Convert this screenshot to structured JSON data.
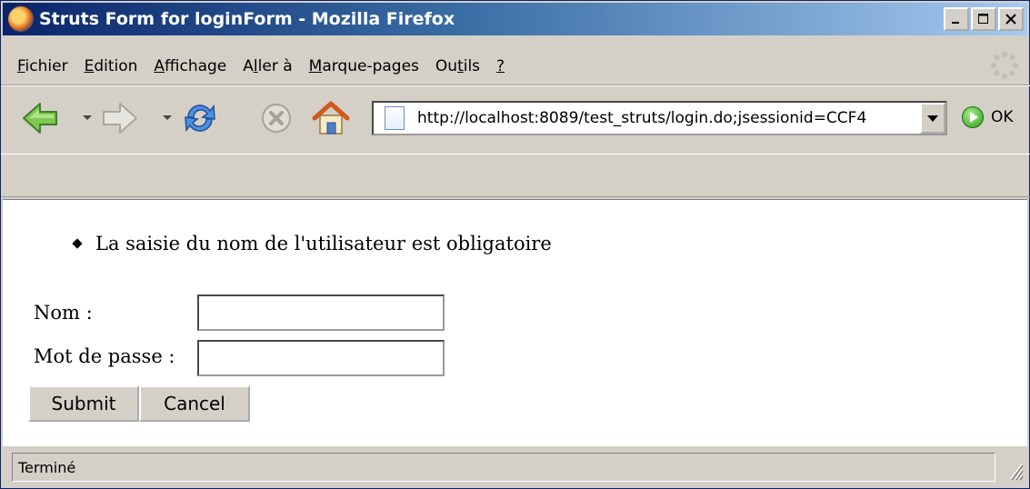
{
  "window": {
    "title": "Struts Form for loginForm - Mozilla Firefox",
    "controls": {
      "minimize": "_",
      "maximize": "□",
      "close": "×"
    }
  },
  "menu": [
    {
      "pre": "",
      "key": "F",
      "post": "ichier"
    },
    {
      "pre": "",
      "key": "E",
      "post": "dition"
    },
    {
      "pre": "",
      "key": "A",
      "post": "ffichage"
    },
    {
      "pre": "A",
      "key": "l",
      "post": "ler à"
    },
    {
      "pre": "",
      "key": "M",
      "post": "arque-pages"
    },
    {
      "pre": "Ou",
      "key": "t",
      "post": "ils"
    },
    {
      "pre": "",
      "key": "?",
      "post": ""
    }
  ],
  "toolbar": {
    "url": "http://localhost:8089/test_struts/login.do;jsessionid=CCF4",
    "go_label": "OK"
  },
  "page": {
    "error_message": "La saisie du nom de l'utilisateur est obligatoire",
    "name_label": "Nom :",
    "password_label": "Mot de passe :",
    "name_value": "",
    "password_value": "",
    "submit_label": "Submit",
    "cancel_label": "Cancel"
  },
  "status": {
    "text": "Terminé"
  },
  "colors": {
    "title_start": "#0a246a",
    "title_end": "#a6caf0",
    "chrome": "#d4d0c8"
  }
}
